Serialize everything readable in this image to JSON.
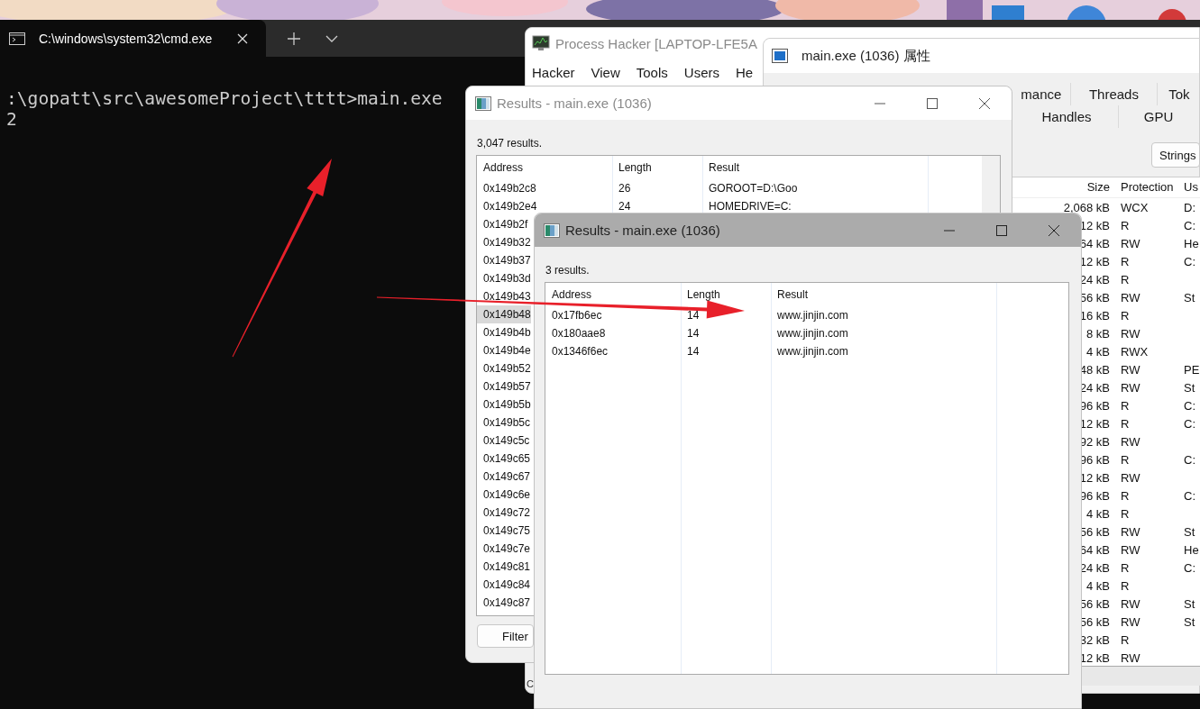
{
  "terminal": {
    "tab_title": "C:\\windows\\system32\\cmd.exe",
    "lines": [
      ":\\gopatt\\src\\awesomeProject\\tttt>main.exe",
      "2"
    ]
  },
  "process_hacker": {
    "title": "Process Hacker [LAPTOP-LFE5A",
    "menu": [
      "Hacker",
      "View",
      "Tools",
      "Users",
      "He"
    ],
    "status_text": "C"
  },
  "properties": {
    "title": "main.exe (1036) 属性",
    "tabs_row_1": [
      "mance",
      "Threads",
      "Tok"
    ],
    "tabs_row_2": [
      "Handles",
      "GPU"
    ],
    "strings_button": "Strings",
    "columns": [
      "Size",
      "Protection",
      "Us"
    ],
    "rows": [
      {
        "size": "2,068 kB",
        "protection": "WCX",
        "use": "D:"
      },
      {
        "size": "12 kB",
        "protection": "R",
        "use": "C:"
      },
      {
        "size": "64 kB",
        "protection": "RW",
        "use": "He"
      },
      {
        "size": "12 kB",
        "protection": "R",
        "use": "C:"
      },
      {
        "size": "24 kB",
        "protection": "R"
      },
      {
        "size": "56 kB",
        "protection": "RW",
        "use": "St"
      },
      {
        "size": "16 kB",
        "protection": "R"
      },
      {
        "size": "8 kB",
        "protection": "RW"
      },
      {
        "size": "4 kB",
        "protection": "RWX"
      },
      {
        "size": "48 kB",
        "protection": "RW",
        "use": "PE"
      },
      {
        "size": "24 kB",
        "protection": "RW",
        "use": "St"
      },
      {
        "size": "96 kB",
        "protection": "R",
        "use": "C:"
      },
      {
        "size": "12 kB",
        "protection": "R",
        "use": "C:"
      },
      {
        "size": "92 kB",
        "protection": "RW"
      },
      {
        "size": "96 kB",
        "protection": "R",
        "use": "C:"
      },
      {
        "size": "12 kB",
        "protection": "RW"
      },
      {
        "size": "96 kB",
        "protection": "R",
        "use": "C:"
      },
      {
        "size": "4 kB",
        "protection": "R"
      },
      {
        "size": "56 kB",
        "protection": "RW",
        "use": "St"
      },
      {
        "size": "64 kB",
        "protection": "RW",
        "use": "He"
      },
      {
        "size": "24 kB",
        "protection": "R",
        "use": "C:"
      },
      {
        "size": "4 kB",
        "protection": "R"
      },
      {
        "size": "56 kB",
        "protection": "RW",
        "use": "St"
      },
      {
        "size": "56 kB",
        "protection": "RW",
        "use": "St"
      },
      {
        "size": "32 kB",
        "protection": "R"
      },
      {
        "size": "12 kB",
        "protection": "RW"
      }
    ]
  },
  "results_windows": [
    {
      "title": "Results - main.exe (1036)",
      "active": false,
      "count_text": "3,047 results.",
      "columns": [
        "Address",
        "Length",
        "Result"
      ],
      "buttons": [
        "Filter"
      ],
      "rows": [
        {
          "address": "0x149b2c8",
          "length": "26",
          "result": "GOROOT=D:\\Goo",
          "selected": false
        },
        {
          "address": "0x149b2e4",
          "length": "24",
          "result": "HOMEDRIVE=C:",
          "selected": false
        },
        {
          "address": "0x149b2f",
          "selected": false
        },
        {
          "address": "0x149b32",
          "selected": false
        },
        {
          "address": "0x149b37",
          "selected": false
        },
        {
          "address": "0x149b3d",
          "selected": false
        },
        {
          "address": "0x149b43",
          "selected": false
        },
        {
          "address": "0x149b48",
          "selected": true
        },
        {
          "address": "0x149b4b",
          "selected": false
        },
        {
          "address": "0x149b4e",
          "selected": false
        },
        {
          "address": "0x149b52",
          "selected": false
        },
        {
          "address": "0x149b57",
          "selected": false
        },
        {
          "address": "0x149b5b",
          "selected": false
        },
        {
          "address": "0x149b5c",
          "selected": false
        },
        {
          "address": "0x149c5c",
          "selected": false
        },
        {
          "address": "0x149c65",
          "selected": false
        },
        {
          "address": "0x149c67",
          "selected": false
        },
        {
          "address": "0x149c6e",
          "selected": false
        },
        {
          "address": "0x149c72",
          "selected": false
        },
        {
          "address": "0x149c75",
          "selected": false
        },
        {
          "address": "0x149c7e",
          "selected": false
        },
        {
          "address": "0x149c81",
          "selected": false
        },
        {
          "address": "0x149c84",
          "selected": false
        },
        {
          "address": "0x149c87",
          "selected": false
        }
      ]
    },
    {
      "title": "Results - main.exe (1036)",
      "active": true,
      "count_text": "3 results.",
      "columns": [
        "Address",
        "Length",
        "Result"
      ],
      "rows": [
        {
          "address": "0x17fb6ec",
          "length": "14",
          "result": "www.jinjin.com",
          "selected": false
        },
        {
          "address": "0x180aae8",
          "length": "14",
          "result": "www.jinjin.com",
          "selected": false
        },
        {
          "address": "0x1346f6ec",
          "length": "14",
          "result": "www.jinjin.com",
          "selected": false
        }
      ]
    }
  ],
  "annotations": [
    {
      "kind": "arrow"
    },
    {
      "kind": "arrow"
    }
  ]
}
